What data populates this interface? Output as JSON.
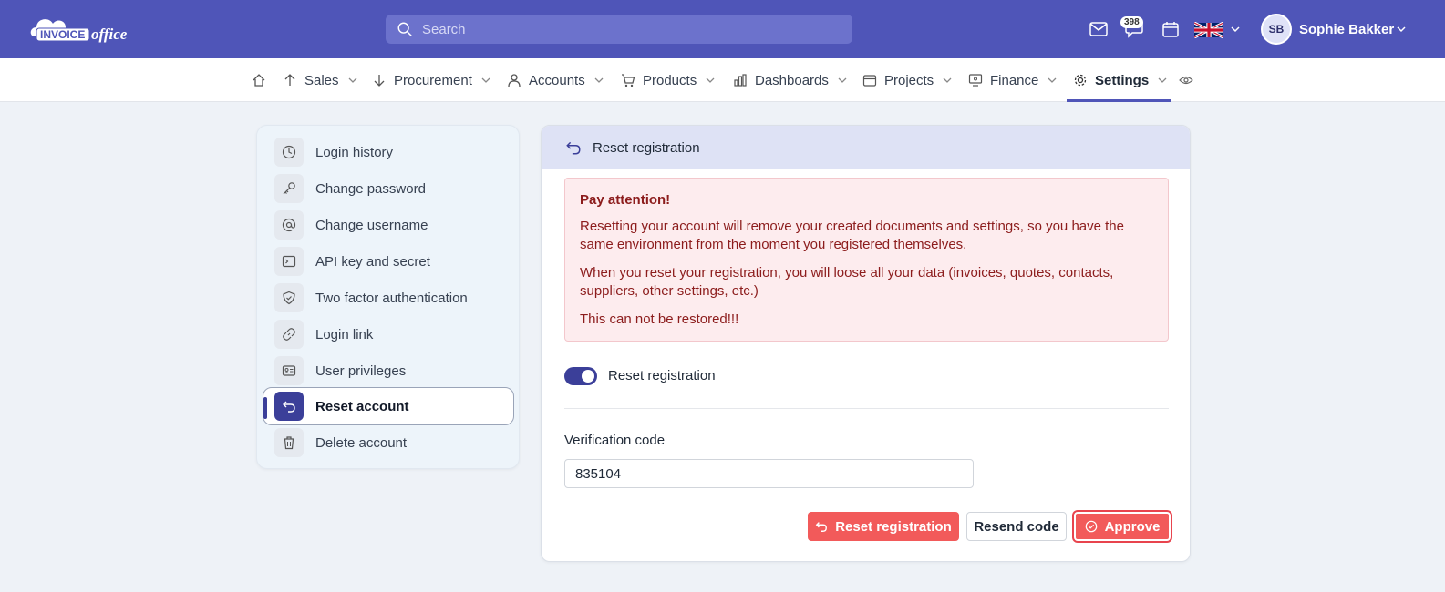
{
  "header": {
    "logo_text": "INVOICEoffice",
    "search_placeholder": "Search",
    "notifications_count": "398",
    "user_initials": "SB",
    "user_name": "Sophie Bakker",
    "brand_color": "#4f55b8"
  },
  "nav": {
    "items": [
      {
        "label": "Sales",
        "icon": "arrow-up-icon"
      },
      {
        "label": "Procurement",
        "icon": "arrow-down-icon"
      },
      {
        "label": "Accounts",
        "icon": "user-icon"
      },
      {
        "label": "Products",
        "icon": "cart-icon"
      },
      {
        "label": "Dashboards",
        "icon": "bar-chart-icon"
      },
      {
        "label": "Projects",
        "icon": "calendar-icon"
      },
      {
        "label": "Finance",
        "icon": "monitor-icon"
      },
      {
        "label": "Settings",
        "icon": "gear-icon",
        "active": true
      }
    ]
  },
  "sidebar": {
    "items": [
      {
        "label": "Login history",
        "icon": "clock-icon"
      },
      {
        "label": "Change password",
        "icon": "key-icon"
      },
      {
        "label": "Change username",
        "icon": "at-icon"
      },
      {
        "label": "API key and secret",
        "icon": "terminal-icon"
      },
      {
        "label": "Two factor authentication",
        "icon": "shield-icon"
      },
      {
        "label": "Login link",
        "icon": "link-icon"
      },
      {
        "label": "User privileges",
        "icon": "id-card-icon"
      },
      {
        "label": "Reset account",
        "icon": "undo-icon",
        "active": true
      },
      {
        "label": "Delete account",
        "icon": "trash-icon"
      }
    ]
  },
  "panel": {
    "title": "Reset registration",
    "alert": {
      "title": "Pay attention!",
      "line1": "Resetting your account will remove your created documents and settings, so you have the same environment from the moment you registered themselves.",
      "line2": "When you reset your registration, you will loose all your data (invoices, quotes, contacts, suppliers, other settings, etc.)",
      "line3": "This can not be restored!!!"
    },
    "toggle_label": "Reset registration",
    "toggle_on": true,
    "verification_label": "Verification code",
    "verification_value": "835104",
    "buttons": {
      "reset": "Reset registration",
      "resend": "Resend code",
      "approve": "Approve"
    }
  }
}
